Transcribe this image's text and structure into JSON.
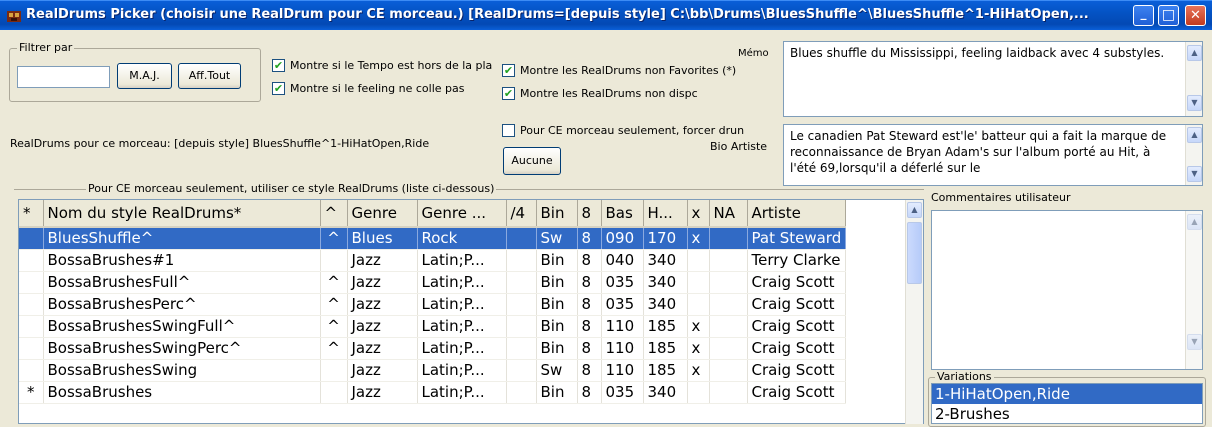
{
  "window": {
    "title": "RealDrums Picker (choisir une RealDrum pour CE morceau.) [RealDrums=[depuis style] C:\\bb\\Drums\\BluesShuffle^\\BluesShuffle^1-HiHatOpen,...",
    "min_glyph": "_",
    "max_glyph": "□",
    "close_glyph": "✕"
  },
  "filter": {
    "legend": "Filtrer par",
    "input_value": "",
    "update_label": "M.A.J.",
    "show_all_label": "Aff.Tout"
  },
  "options": {
    "tempo_check": {
      "label": "Montre si le Tempo est hors de la pla",
      "checked": "✔"
    },
    "feeling_check": {
      "label": "Montre si le feeling ne colle pas",
      "checked": "✔"
    },
    "non_fav_check": {
      "label": "Montre les RealDrums non Favorites (*)",
      "checked": "✔"
    },
    "non_dispo_check": {
      "label": "Montre les RealDrums non dispc",
      "checked": "✔"
    },
    "force_check": {
      "label": "Pour CE morceau seulement, forcer drun",
      "checked": ""
    }
  },
  "memo": {
    "label": "Mémo",
    "text": "Blues shuffle du Mississippi, feeling laidback avec 4 substyles."
  },
  "bio": {
    "label": "Bio Artiste",
    "text": "Le canadien Pat Steward est'le' batteur qui a fait la marque de reconnaissance de Bryan Adam's sur l'album porté au Hit, à l'été 69,lorsqu'il a déferlé sur le"
  },
  "current": "RealDrums pour ce morceau: [depuis style] BluesShuffle^1-HiHatOpen,Ride",
  "none_button": "Aucune",
  "list_group_legend": "Pour CE morceau seulement, utiliser ce style RealDrums (liste ci-dessous)",
  "grid": {
    "columns": [
      "*",
      "Nom du style RealDrums*",
      "^",
      "Genre",
      "Genre ...",
      "/4",
      "Bin",
      "8",
      "Bas",
      "H...",
      "x",
      "NA",
      "Artiste"
    ],
    "rows": [
      [
        "",
        "BluesShuffle^",
        "^",
        "Blues",
        "Rock",
        "",
        "Sw",
        "8",
        "090",
        "170",
        "x",
        "",
        "Pat Steward"
      ],
      [
        "",
        "BossaBrushes#1",
        "",
        "Jazz",
        "Latin;P...",
        "",
        "Bin",
        "8",
        "040",
        "340",
        "",
        "",
        "Terry Clarke"
      ],
      [
        "",
        "BossaBrushesFull^",
        "^",
        "Jazz",
        "Latin;P...",
        "",
        "Bin",
        "8",
        "035",
        "340",
        "",
        "",
        "Craig Scott"
      ],
      [
        "",
        "BossaBrushesPerc^",
        "^",
        "Jazz",
        "Latin;P...",
        "",
        "Bin",
        "8",
        "035",
        "340",
        "",
        "",
        "Craig Scott"
      ],
      [
        "",
        "BossaBrushesSwingFull^",
        "^",
        "Jazz",
        "Latin;P...",
        "",
        "Bin",
        "8",
        "110",
        "185",
        "x",
        "",
        "Craig Scott"
      ],
      [
        "",
        "BossaBrushesSwingPerc^",
        "^",
        "Jazz",
        "Latin;P...",
        "",
        "Bin",
        "8",
        "110",
        "185",
        "x",
        "",
        "Craig Scott"
      ],
      [
        "",
        "BossaBrushesSwing",
        "",
        "Jazz",
        "Latin;P...",
        "",
        "Sw",
        "8",
        "110",
        "185",
        "x",
        "",
        "Craig Scott"
      ],
      [
        "*",
        "BossaBrushes",
        "",
        "Jazz",
        "Latin;P...",
        "",
        "Bin",
        "8",
        "035",
        "340",
        "",
        "",
        "Craig Scott"
      ]
    ]
  },
  "comments": {
    "label": "Commentaires utilisateur",
    "text": ""
  },
  "variations": {
    "legend": "Variations",
    "items": [
      "1-HiHatOpen,Ride",
      "2-Brushes"
    ],
    "selected": "1-HiHatOpen,Ride"
  },
  "colors": {
    "titlebar": "#0453c4",
    "selection": "#316ac5",
    "face": "#ece9d8"
  }
}
